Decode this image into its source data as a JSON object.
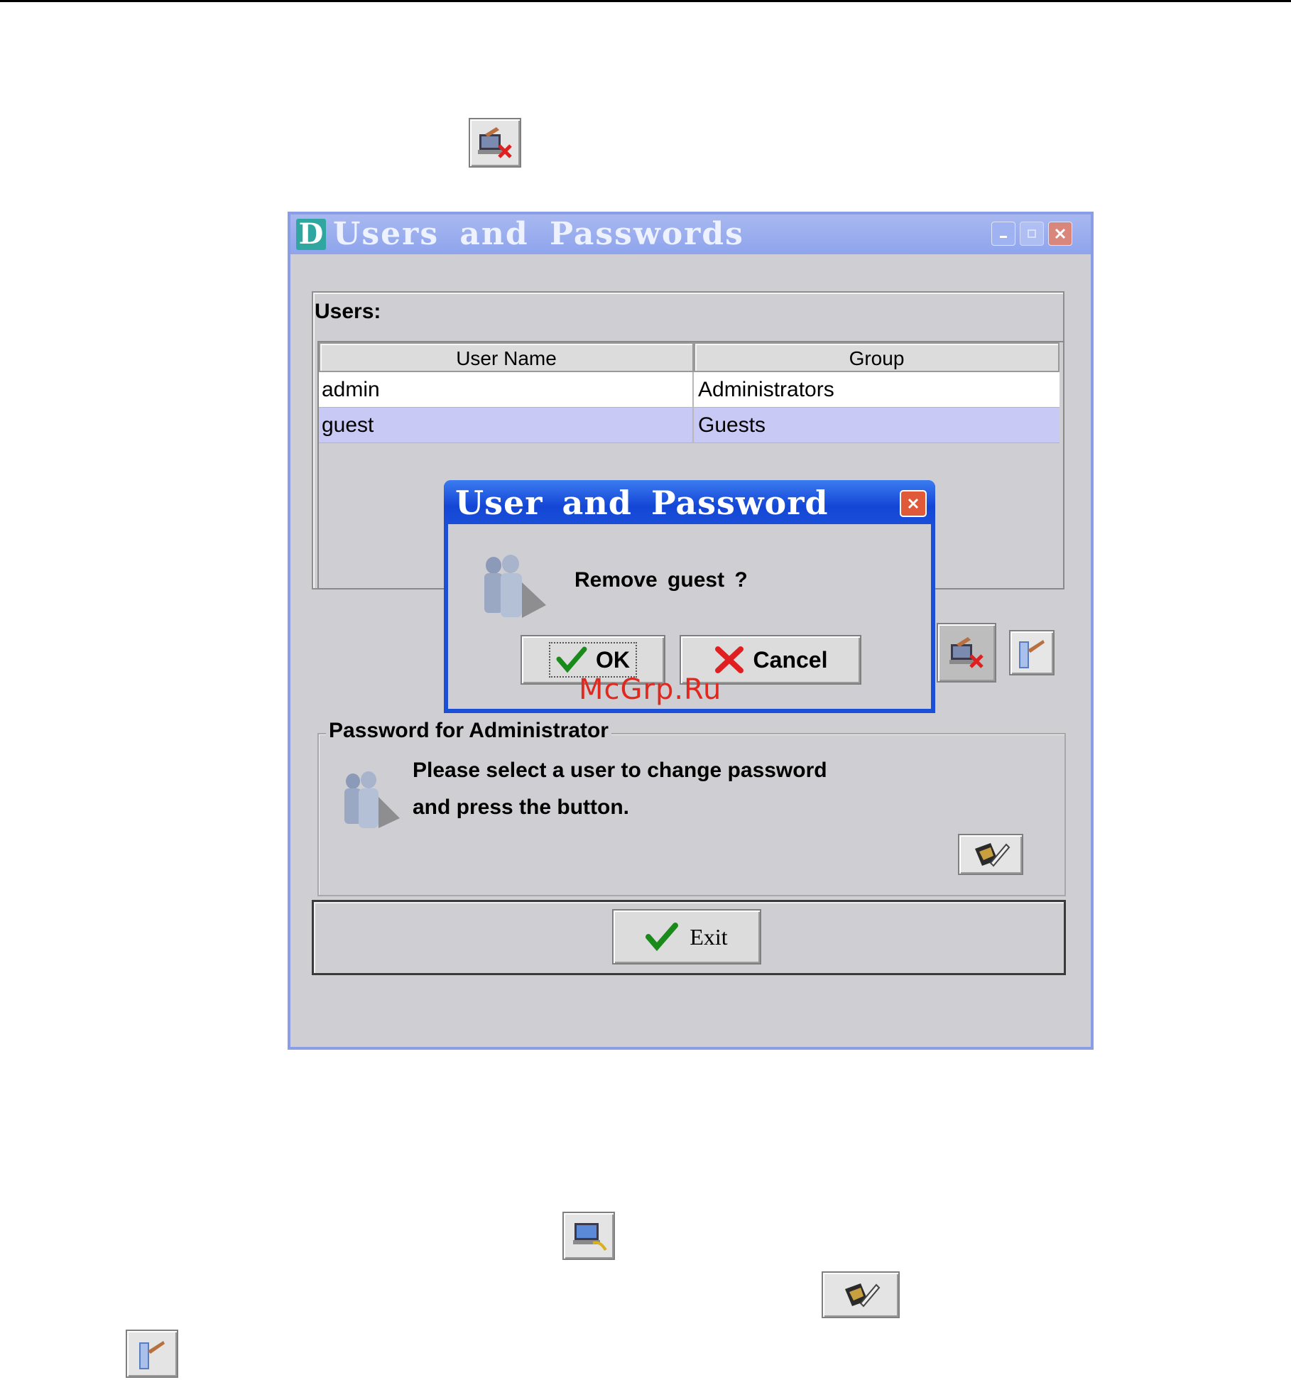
{
  "window": {
    "logo": "D",
    "title": "Users and Passwords"
  },
  "users": {
    "label": "Users:",
    "columns": [
      "User Name",
      "Group"
    ],
    "rows": [
      {
        "user": "admin",
        "group": "Administrators",
        "selected": false
      },
      {
        "user": "guest",
        "group": "Guests",
        "selected": true
      }
    ]
  },
  "password": {
    "legend": "Password for Administrator",
    "line1": "Please select a user to change password",
    "line2": "and press the button."
  },
  "exit": {
    "label": "Exit"
  },
  "dialog": {
    "title": "User and Password",
    "message": "Remove  guest ?",
    "ok_label": "OK",
    "cancel_label": "Cancel"
  },
  "watermark": "McGrp.Ru",
  "icons": {
    "remove_user": "remove-user-icon",
    "add_user": "add-user-icon",
    "change_password": "change-password-icon",
    "modify_user": "modify-user-icon",
    "users_group": "users-group-icon",
    "check": "check-icon",
    "cross": "cross-icon"
  },
  "colors": {
    "window_border": "#8a9ee8",
    "dialog_title": "#1446d6",
    "selected_row": "#c9c9f6",
    "check_green": "#1a8a1a",
    "cross_red": "#e02020",
    "watermark_red": "#e0281e"
  }
}
